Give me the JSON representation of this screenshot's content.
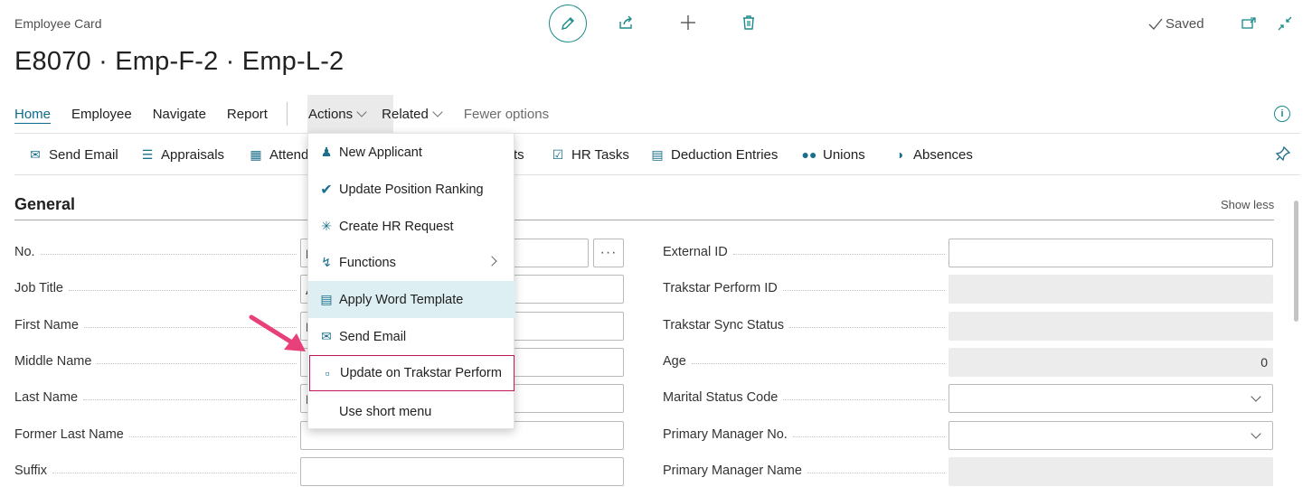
{
  "header": {
    "card_label": "Employee Card",
    "title": "E8070 · Emp-F-2 · Emp-L-2",
    "saved_label": "Saved"
  },
  "nav": {
    "home": "Home",
    "employee": "Employee",
    "navigate": "Navigate",
    "report": "Report",
    "actions": "Actions",
    "related": "Related",
    "fewer_options": "Fewer options"
  },
  "action_bar": {
    "send_email": "Send Email",
    "appraisals": "Appraisals",
    "attendance": "Attend",
    "ts_suffix": "ts",
    "hr_tasks": "HR Tasks",
    "deduction_entries": "Deduction Entries",
    "unions": "Unions",
    "absences": "Absences"
  },
  "section": {
    "title": "General",
    "show_less": "Show less"
  },
  "left_fields": [
    {
      "label": "No.",
      "peek": "E"
    },
    {
      "label": "Job Title",
      "peek": "A"
    },
    {
      "label": "First Name",
      "peek": "E"
    },
    {
      "label": "Middle Name",
      "peek": ""
    },
    {
      "label": "Last Name",
      "peek": "E"
    },
    {
      "label": "Former Last Name",
      "peek": ""
    },
    {
      "label": "Suffix",
      "peek": ""
    }
  ],
  "right_fields": [
    {
      "label": "External ID",
      "value": ""
    },
    {
      "label": "Trakstar Perform ID",
      "value": ""
    },
    {
      "label": "Trakstar Sync Status",
      "value": ""
    },
    {
      "label": "Age",
      "value": "0"
    },
    {
      "label": "Marital Status Code",
      "value": ""
    },
    {
      "label": "Primary Manager No.",
      "value": ""
    },
    {
      "label": "Primary Manager Name",
      "value": ""
    }
  ],
  "actions_menu": {
    "items": [
      {
        "label": "New Applicant"
      },
      {
        "label": "Update Position Ranking"
      },
      {
        "label": "Create HR Request"
      },
      {
        "label": "Functions"
      },
      {
        "label": "Apply Word Template"
      },
      {
        "label": "Send Email"
      },
      {
        "label": "Update on Trakstar Perform"
      },
      {
        "label": "Use short menu"
      }
    ]
  },
  "colors": {
    "accent": "#1b8a8a",
    "highlight": "#ddeff2",
    "callout": "#c2185b",
    "arrow": "#e8407a"
  }
}
